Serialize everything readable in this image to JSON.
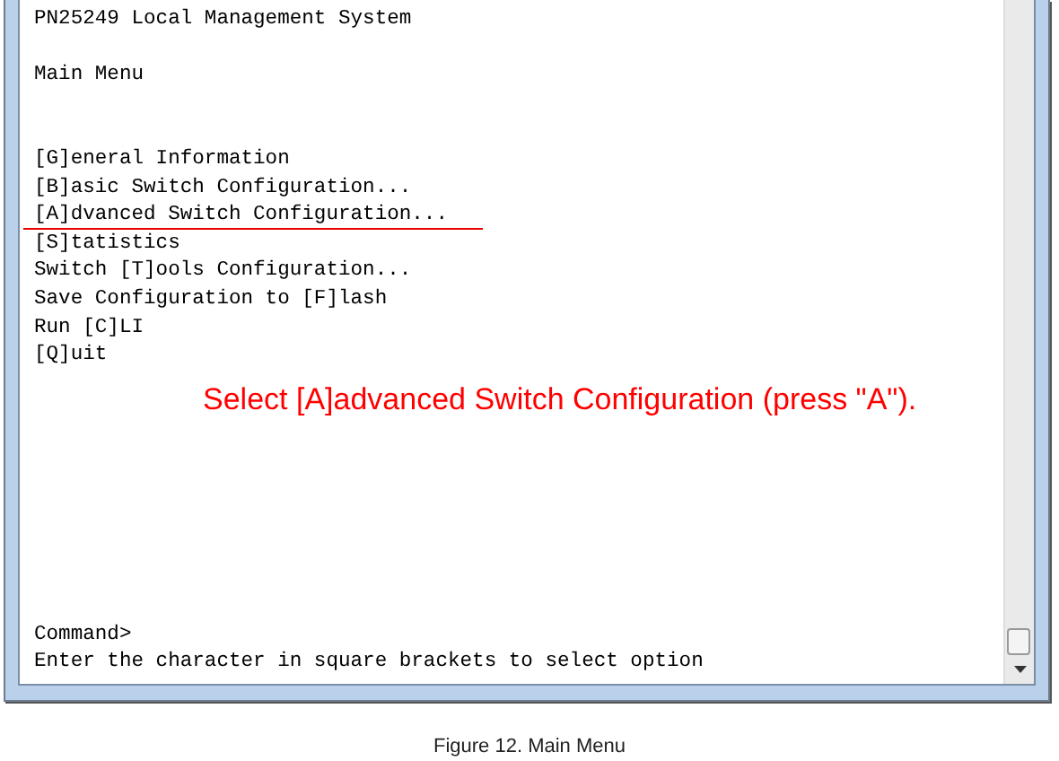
{
  "terminal": {
    "title": "PN25249 Local Management System",
    "heading": "Main Menu",
    "menu_items": [
      {
        "text": "[G]eneral Information",
        "underlined": false
      },
      {
        "text": "[B]asic Switch Configuration...",
        "underlined": false
      },
      {
        "text": "[A]dvanced Switch Configuration...",
        "underlined": true
      },
      {
        "text": "[S]tatistics",
        "underlined": false
      },
      {
        "text": "Switch [T]ools Configuration...",
        "underlined": false
      },
      {
        "text": "Save Configuration to [F]lash",
        "underlined": false
      },
      {
        "text": "Run [C]LI",
        "underlined": false
      },
      {
        "text": "[Q]uit",
        "underlined": false
      }
    ],
    "prompt": "Command>",
    "hint": "Enter the character in square brackets to select option"
  },
  "annotation": "Select [A]advanced Switch Configuration (press \"A\").",
  "caption": "Figure 12. Main Menu"
}
